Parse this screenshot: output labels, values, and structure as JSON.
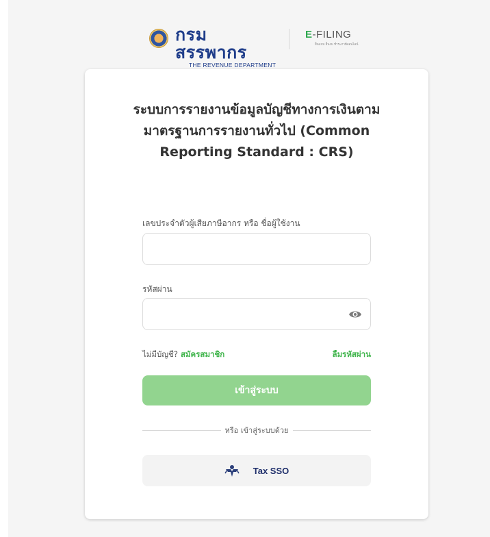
{
  "header": {
    "rd_name_thai": "กรมสรรพากร",
    "rd_name_eng": "THE REVENUE DEPARTMENT",
    "efiling_prefix": "E",
    "efiling_rest": "-FILING",
    "efiling_sub": "ยื่นแบบ ยื่นงบ ชำระภาษีออนไลน์"
  },
  "form": {
    "title": "ระบบการรายงานข้อมูลบัญชีทางการเงินตามมาตรฐานการรายงานทั่วไป (Common Reporting Standard : CRS)",
    "username_label": "เลขประจำตัวผู้เสียภาษีอากร หรือ ชื่อผู้ใช้งาน",
    "username_value": "",
    "password_label": "รหัสผ่าน",
    "password_value": "",
    "no_account_text": "ไม่มีบัญชี?",
    "register_link": "สมัครสมาชิก",
    "forgot_link": "ลืมรหัสผ่าน",
    "login_button": "เข้าสู่ระบบ",
    "or_text": "หรือ เข้าสู่ระบบด้วย",
    "sso_button": "Tax SSO"
  },
  "colors": {
    "accent_green": "#3eb44a",
    "login_button_bg": "#92d48f",
    "brand_blue": "#1f3d8a"
  }
}
